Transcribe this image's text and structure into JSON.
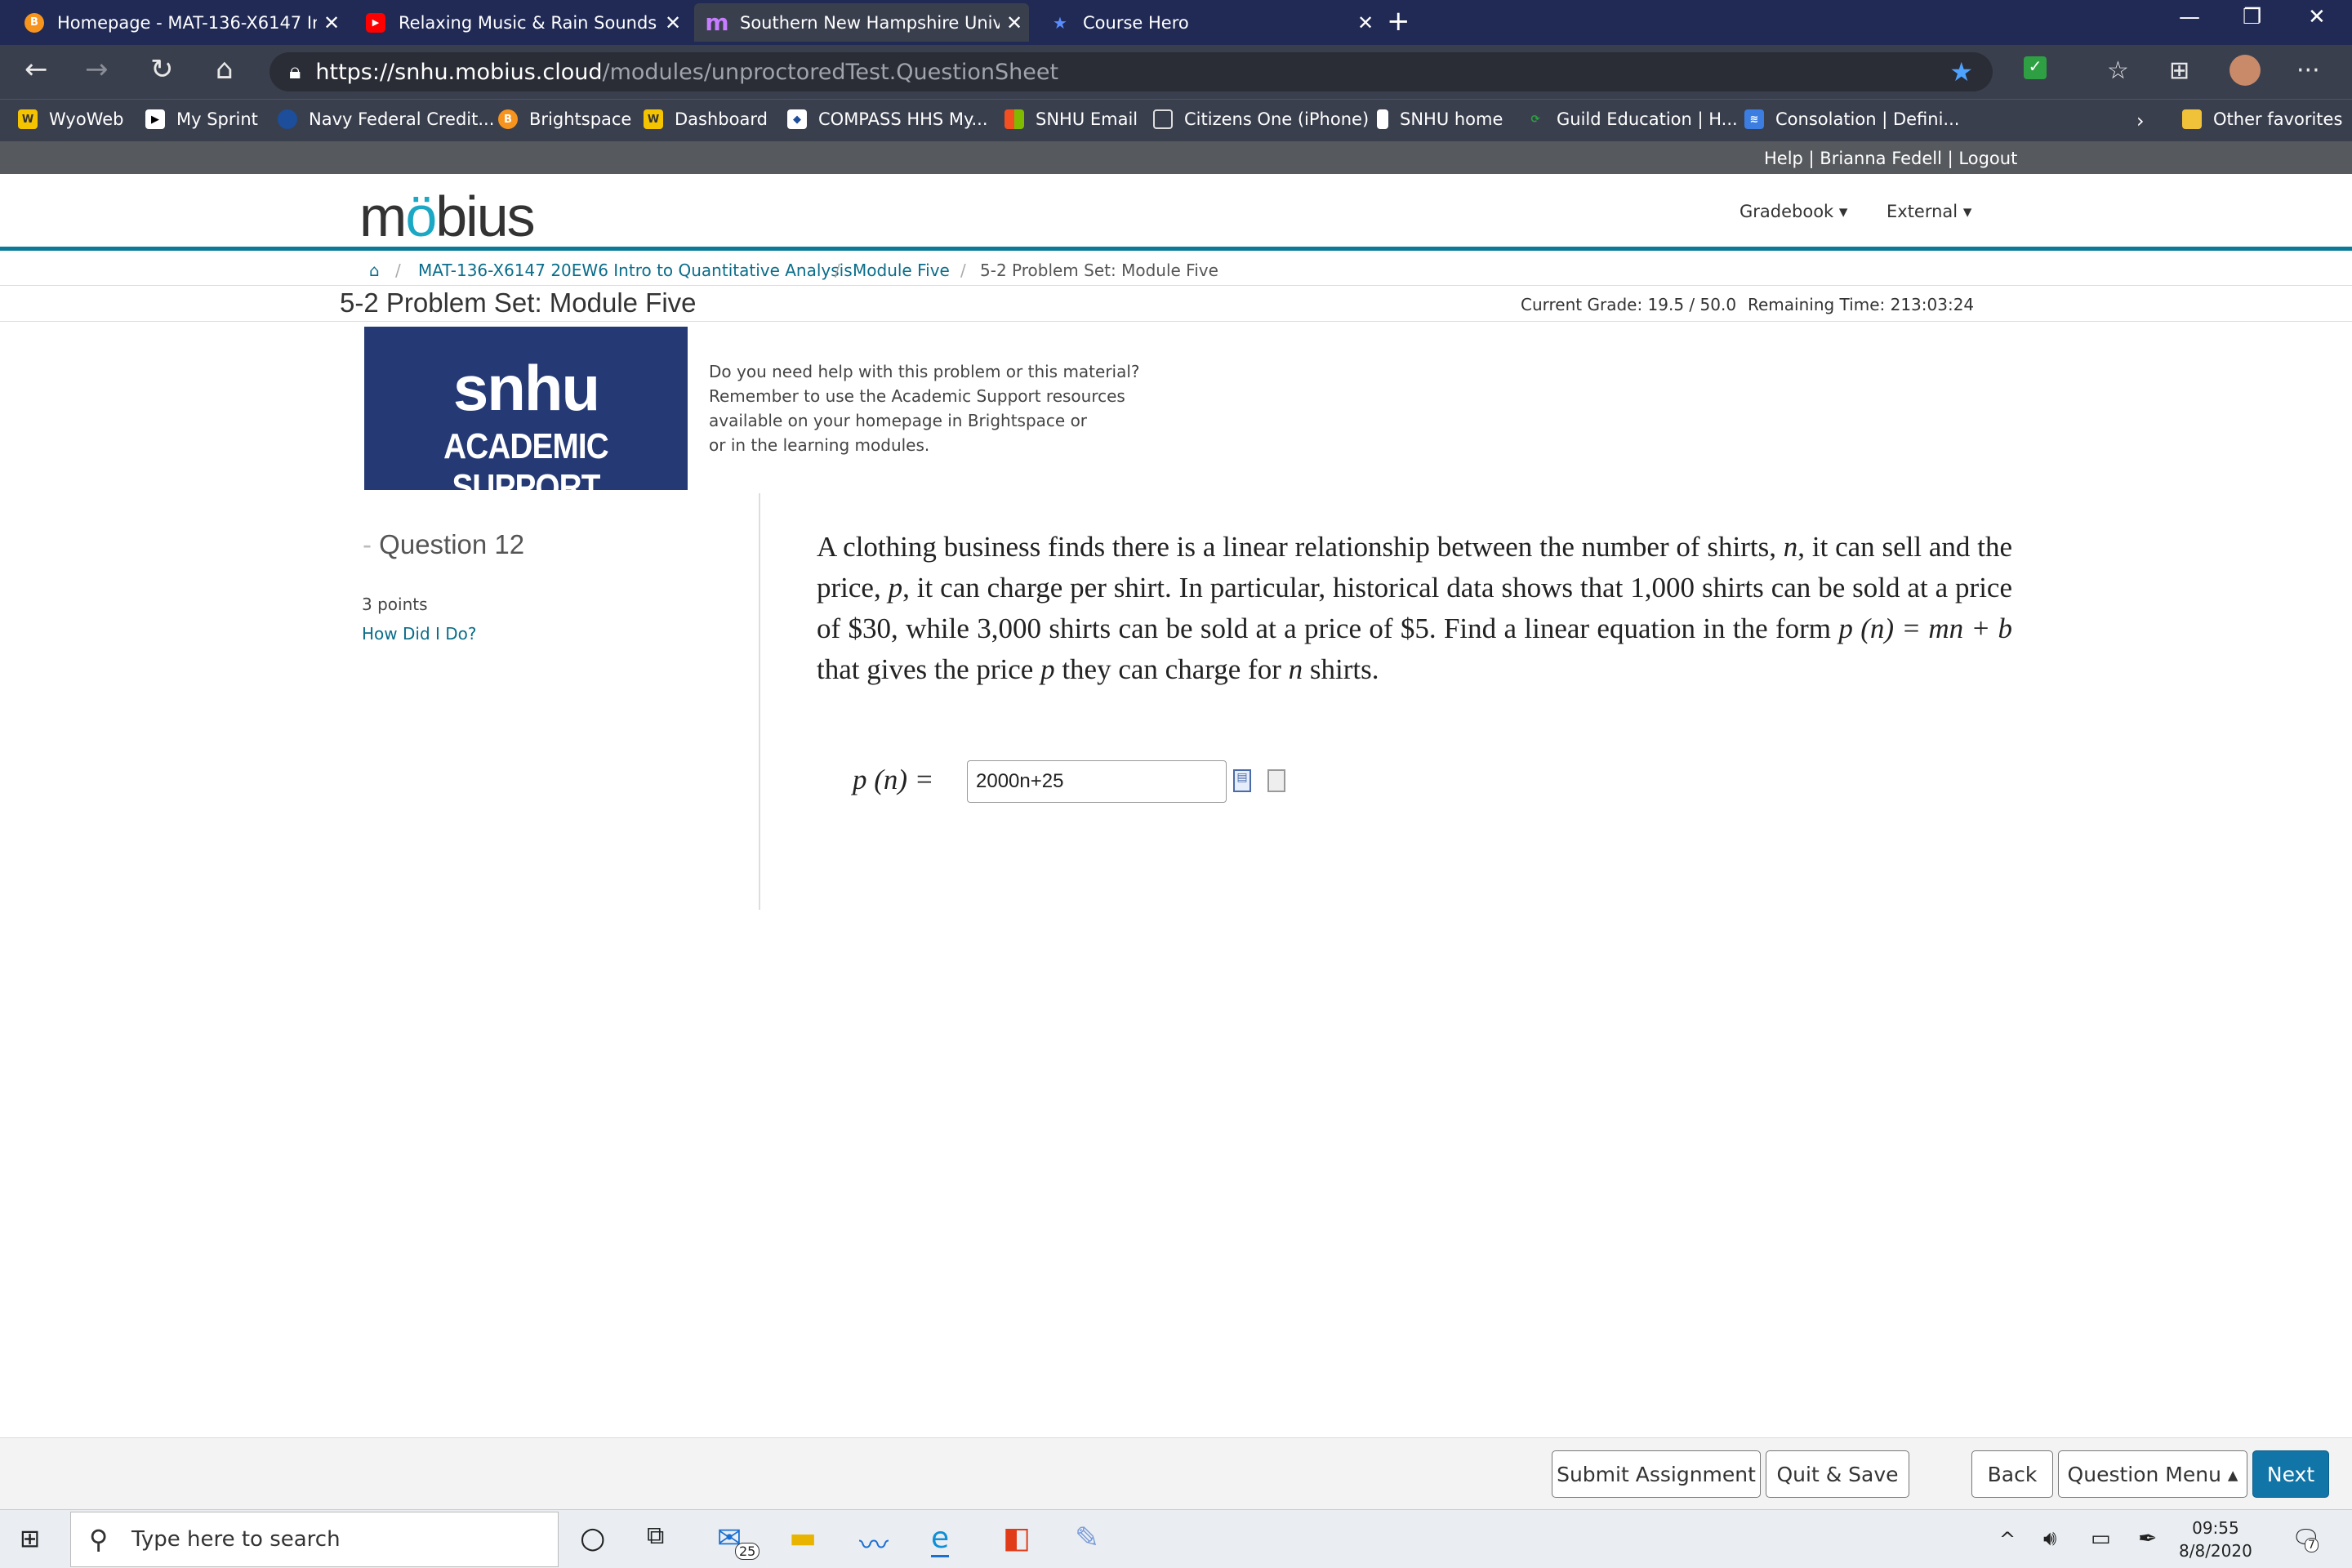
{
  "browser": {
    "tabs": [
      {
        "title": "Homepage - MAT-136-X6147 Int",
        "icon": "brightspace-icon",
        "active": false
      },
      {
        "title": "Relaxing Music & Rain Sounds -",
        "icon": "youtube-icon",
        "active": false
      },
      {
        "title": "Southern New Hampshire Univer",
        "icon": "mobius-icon",
        "active": true
      },
      {
        "title": "Course Hero",
        "icon": "course-hero-icon",
        "active": false
      }
    ],
    "url_host": "https://snhu.mobius.cloud",
    "url_path": "/modules/unproctoredTest.QuestionSheet",
    "favorites": [
      "WyoWeb",
      "My Sprint",
      "Navy Federal Credit...",
      "Brightspace",
      "Dashboard",
      "COMPASS HHS My...",
      "SNHU Email",
      "Citizens One (iPhone)",
      "SNHU home",
      "Guild Education | H...",
      "Consolation | Defini..."
    ],
    "other_favorites": "Other favorites"
  },
  "mobius": {
    "top_links": "Help | Brianna Fedell | Logout",
    "logo": "möbius",
    "nav": [
      "Gradebook",
      "External"
    ],
    "breadcrumb": [
      "MAT-136-X6147 20EW6 Intro to Quantitative Analysis",
      "Module Five",
      "5-2 Problem Set: Module Five"
    ],
    "page_title": "5-2 Problem Set: Module Five",
    "current_grade": "Current Grade: 19.5 / 50.0",
    "remaining_time": "Remaining Time:  213:03:24"
  },
  "support": {
    "banner_line1": "snhu",
    "banner_line2": "ACADEMIC SUPPORT",
    "help_lines": [
      "Do you need help with this problem or this material?",
      "Remember to use the Academic Support resources",
      "available on your homepage in Brightspace or",
      "or in the learning modules."
    ]
  },
  "question": {
    "number": "Question 12",
    "points": "3 points",
    "how_did_i_do": "How Did I Do?",
    "text_parts": {
      "t1": "A clothing business finds there is a linear relationship between the number of shirts, ",
      "v_n": "n",
      "t2": ", it can sell and the price, ",
      "v_p": "p",
      "t3": ", it can charge per shirt. In particular, historical data shows that 1,000 shirts can be sold at a price of $30, while 3,000 shirts can be sold at a price of $5. Find a linear equation in the form ",
      "formula": "p (n) = mn + b",
      "t4": " that gives the price ",
      "t5": " they can charge for ",
      "t6": " shirts."
    },
    "answer_label": "p (n) =",
    "answer_value": "2000n+25"
  },
  "footer": {
    "submit": "Submit Assignment",
    "quit_save": "Quit & Save",
    "back": "Back",
    "question_menu": "Question Menu ▴",
    "next": "Next"
  },
  "taskbar": {
    "search_placeholder": "Type here to search",
    "mail_badge": "25",
    "time": "09:55",
    "date": "8/8/2020",
    "notif_badge": "7"
  }
}
